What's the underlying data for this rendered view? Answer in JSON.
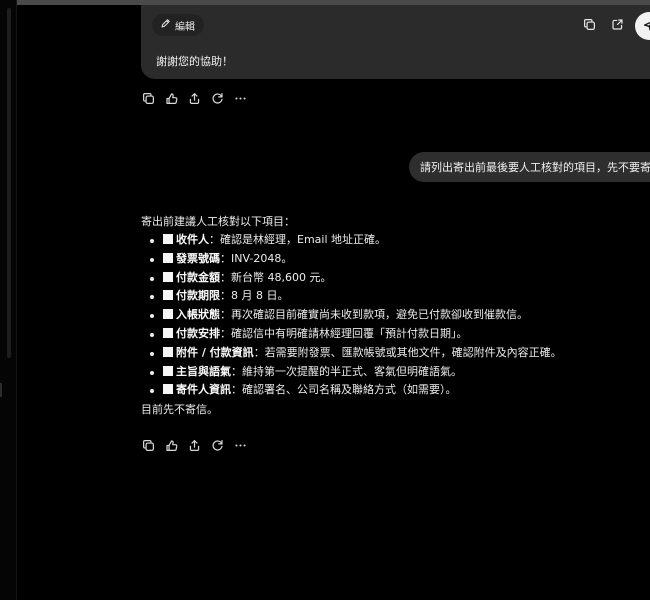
{
  "prev_message": {
    "edit_label": "編輯",
    "text": "謝謝您的協助！"
  },
  "user_message": {
    "text": "請列出寄出前最後要人工核對的項目，先不要寄信。"
  },
  "assistant_reply": {
    "intro": "寄出前建議人工核對以下項目：",
    "items": [
      {
        "label": "收件人",
        "text": "：確認是林經理，Email 地址正確。"
      },
      {
        "label": "發票號碼",
        "text": "：INV-2048。"
      },
      {
        "label": "付款金額",
        "text": "：新台幣 48,600 元。"
      },
      {
        "label": "付款期限",
        "text": "：8 月 8 日。"
      },
      {
        "label": "入帳狀態",
        "text": "：再次確認目前確實尚未收到款項，避免已付款卻收到催款信。"
      },
      {
        "label": "付款安排",
        "text": "：確認信中有明確請林經理回覆「預計付款日期」。"
      },
      {
        "label": "附件 / 付款資訊",
        "text": "：若需要附發票、匯款帳號或其他文件，確認附件及內容正確。"
      },
      {
        "label": "主旨與語氣",
        "text": "：維持第一次提醒的半正式、客氣但明確語氣。"
      },
      {
        "label": "寄件人資訊",
        "text": "：確認署名、公司名稱及聯絡方式（如需要）。"
      }
    ],
    "closing": "目前先不寄信。"
  },
  "icons": {
    "edit": "pencil-icon",
    "copy": "copy-icon",
    "open": "open-external-icon",
    "send": "send-icon",
    "feedback": "feedback-icon",
    "share": "share-icon",
    "regenerate": "regenerate-icon",
    "more": "more-icon"
  }
}
